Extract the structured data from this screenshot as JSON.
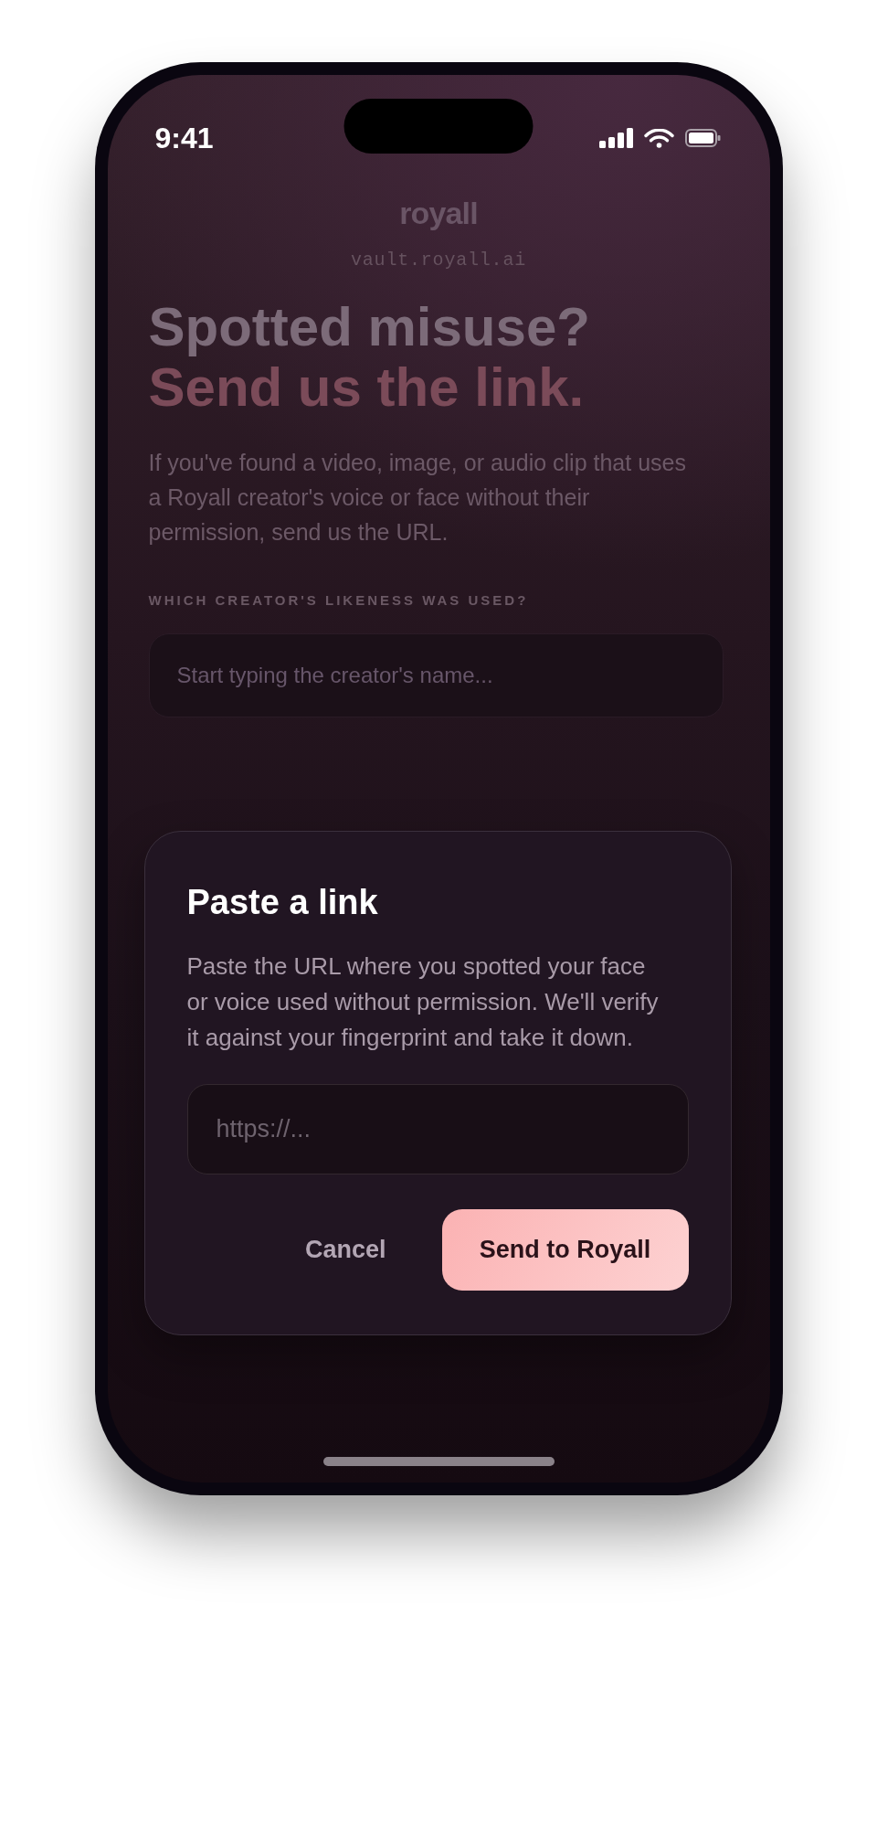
{
  "status_bar": {
    "time": "9:41"
  },
  "background": {
    "logo": "royall",
    "domain": "vault.royall.ai",
    "headline": [
      {
        "text": "Spotted misuse?",
        "kind": "plain"
      },
      {
        "text": "Send us the link.",
        "kind": "accent"
      }
    ],
    "intro": "If you've found a video, image, or audio clip that uses a Royall creator's voice or face without their permission, send us the URL.",
    "field_label": "WHICH CREATOR'S LIKENESS WAS USED?",
    "creator_field": {
      "placeholder": "Start typing the creator's name..."
    }
  },
  "dialog": {
    "title": "Paste a link",
    "description": "Paste the URL where you spotted your face or voice used without permission. We'll verify it against your fingerprint and take it down.",
    "url_field": {
      "placeholder": "https://..."
    },
    "buttons": [
      {
        "label": "Cancel",
        "kind": "cancel"
      },
      {
        "label": "Send to Royall",
        "kind": "submit"
      }
    ]
  }
}
